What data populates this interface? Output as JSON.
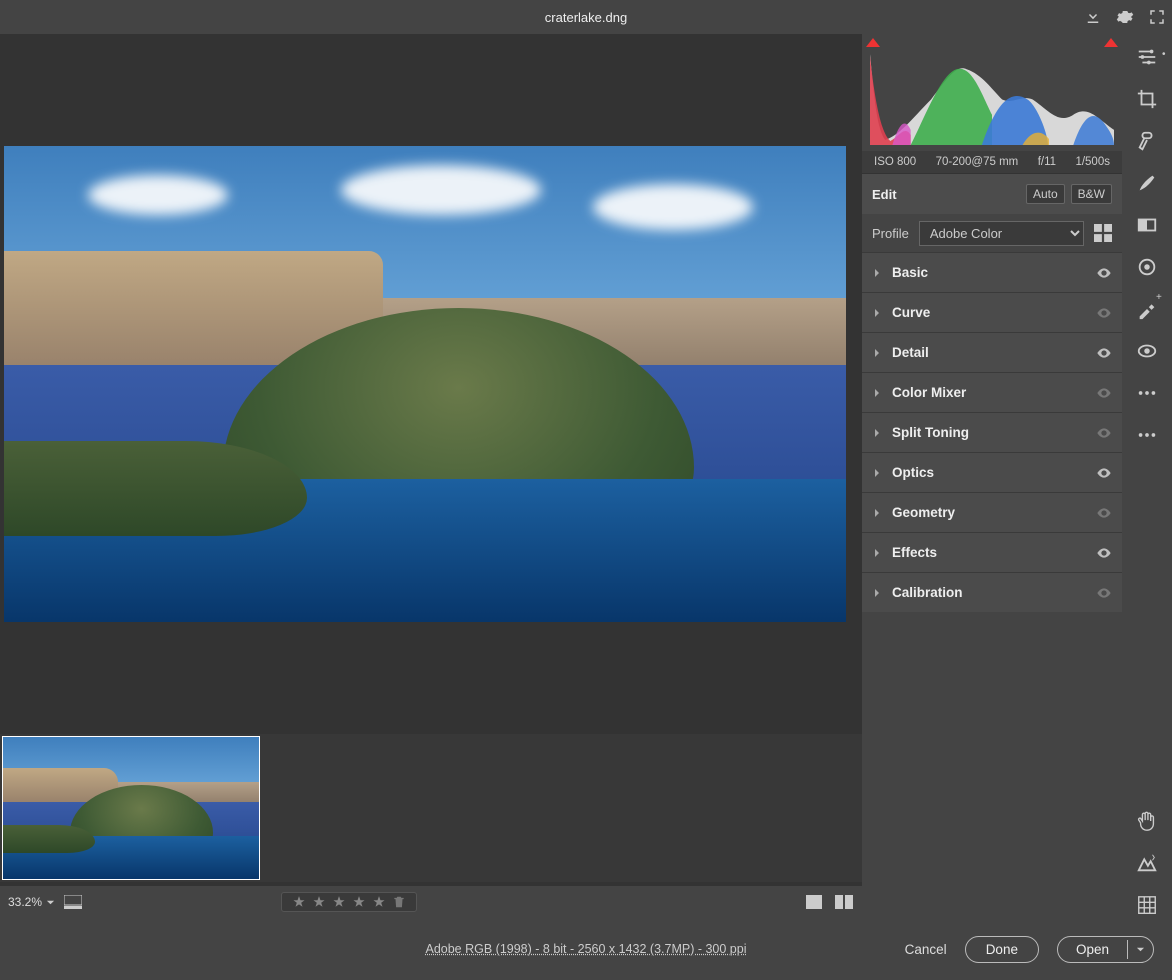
{
  "title": "craterlake.dng",
  "exif": {
    "iso": "ISO 800",
    "lens": "70-200@75 mm",
    "aperture": "f/11",
    "shutter": "1/500s"
  },
  "edit": {
    "title": "Edit",
    "auto": "Auto",
    "bw": "B&W"
  },
  "profile": {
    "label": "Profile",
    "value": "Adobe Color"
  },
  "panels": [
    {
      "name": "Basic",
      "eye": true
    },
    {
      "name": "Curve",
      "eye": false
    },
    {
      "name": "Detail",
      "eye": true
    },
    {
      "name": "Color Mixer",
      "eye": false
    },
    {
      "name": "Split Toning",
      "eye": false
    },
    {
      "name": "Optics",
      "eye": true
    },
    {
      "name": "Geometry",
      "eye": false
    },
    {
      "name": "Effects",
      "eye": true
    },
    {
      "name": "Calibration",
      "eye": false
    }
  ],
  "zoom": "33.2%",
  "meta": "Adobe RGB (1998) - 8 bit - 2560 x 1432 (3.7MP) - 300 ppi",
  "footer": {
    "cancel": "Cancel",
    "done": "Done",
    "open": "Open"
  }
}
